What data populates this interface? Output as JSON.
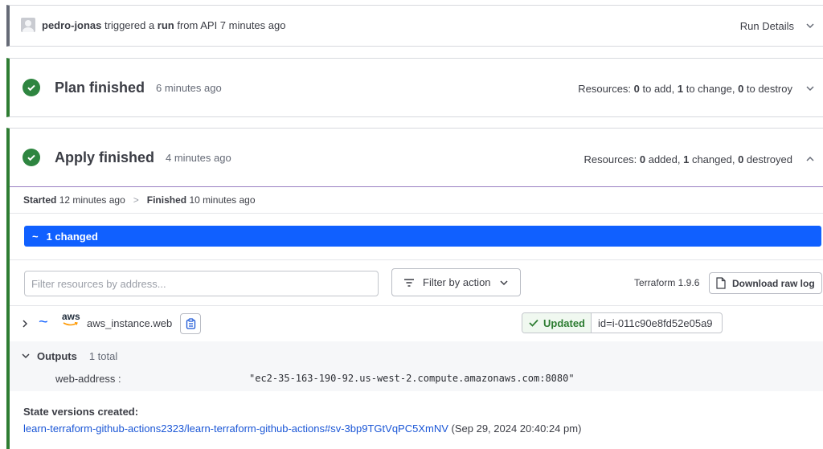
{
  "trigger": {
    "user": "pedro-jonas",
    "text_triggered": " triggered a ",
    "run_word": "run",
    "text_rest": " from API 7 minutes ago",
    "details_label": "Run Details"
  },
  "plan": {
    "title": "Plan finished",
    "time": "6 minutes ago",
    "resources_label": "Resources:",
    "add_count": "0",
    "add_text": " to add, ",
    "change_count": "1",
    "change_text": " to change, ",
    "destroy_count": "0",
    "destroy_text": " to destroy"
  },
  "apply": {
    "title": "Apply finished",
    "time": "4 minutes ago",
    "resources_label": "Resources:",
    "added_count": "0",
    "added_text": " added, ",
    "changed_count": "1",
    "changed_text": " changed, ",
    "destroyed_count": "0",
    "destroyed_text": " destroyed",
    "started_label": "Started",
    "started_time": "12 minutes ago",
    "separator": ">",
    "finished_label": "Finished",
    "finished_time": "10 minutes ago",
    "changed_bar_icon": "~",
    "changed_bar_label": "1 changed"
  },
  "filter": {
    "placeholder": "Filter resources by address...",
    "action_label": "Filter by action",
    "terraform_version": "Terraform 1.9.6",
    "download_label": "Download raw log"
  },
  "resource": {
    "change_symbol": "~",
    "provider": "aws",
    "name": "aws_instance.web",
    "status": "Updated",
    "id": "id=i-011c90e8fd52e05a9"
  },
  "outputs": {
    "title": "Outputs",
    "total": "1 total",
    "key": "web-address :",
    "value": "\"ec2-35-163-190-92.us-west-2.compute.amazonaws.com:8080\""
  },
  "state": {
    "title": "State versions created:",
    "link": "learn-terraform-github-actions2323/learn-terraform-github-actions#sv-3bp9TGtVqPC5XmNV",
    "date": " (Sep 29, 2024 20:40:24 pm)"
  },
  "colors": {
    "success": "#2e8540",
    "accent_blue": "#1060ff",
    "link": "#1a56d6",
    "purple_divider": "#9a7fc2"
  }
}
